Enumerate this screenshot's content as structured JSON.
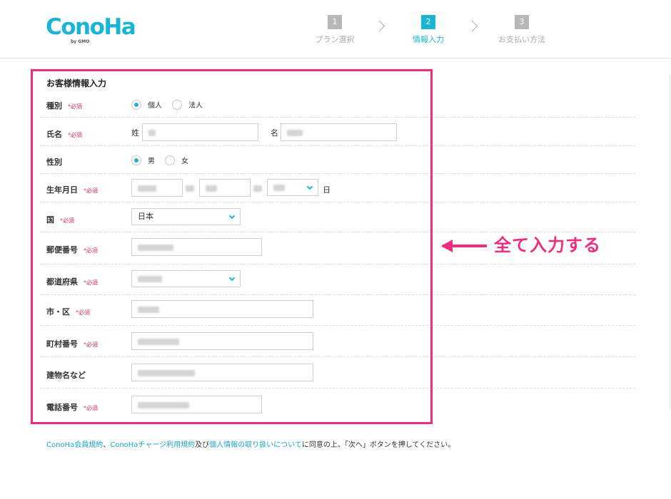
{
  "header": {
    "logo_text": "ConoHa",
    "logo_sub": "by GMO",
    "steps": [
      {
        "num": "1",
        "label": "プラン選択",
        "active": false
      },
      {
        "num": "2",
        "label": "情報入力",
        "active": true
      },
      {
        "num": "3",
        "label": "お支払い方法",
        "active": false
      }
    ]
  },
  "form": {
    "title": "お客様情報入力",
    "required_mark": "*必須",
    "type": {
      "label": "種別",
      "options": [
        "個人",
        "法人"
      ],
      "selected": "個人"
    },
    "name": {
      "label": "氏名",
      "last_prefix": "姓",
      "first_prefix": "名"
    },
    "gender": {
      "label": "性別",
      "options": [
        "男",
        "女"
      ],
      "selected": "男"
    },
    "birthday": {
      "label": "生年月日",
      "day_suffix": "日"
    },
    "country": {
      "label": "国",
      "value": "日本"
    },
    "postal": {
      "label": "郵便番号"
    },
    "prefecture": {
      "label": "都道府県"
    },
    "city": {
      "label": "市・区"
    },
    "town": {
      "label": "町村番号"
    },
    "building": {
      "label": "建物名など"
    },
    "phone": {
      "label": "電話番号"
    }
  },
  "annotation": {
    "text": "全て入力する",
    "color": "#ee2d7c"
  },
  "terms": {
    "link1": "ConoHa会員規約",
    "sep1": "、",
    "link2": "ConoHaチャージ利用規約",
    "sep2": "及び",
    "link3": "個人情報の取り扱いについて",
    "tail": "に同意の上、「次へ」ボタンを押してください。"
  },
  "colors": {
    "accent": "#19b5d2",
    "required": "#e0335c",
    "highlight": "#ee2d7c"
  }
}
